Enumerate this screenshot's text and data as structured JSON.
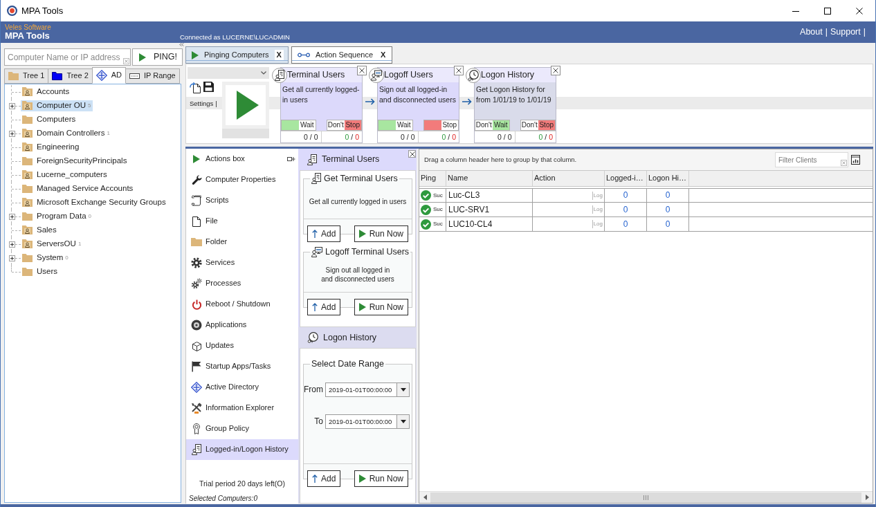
{
  "window": {
    "title": "MPA Tools"
  },
  "header": {
    "company": "Veles Software",
    "product": "MPA Tools",
    "connection": "Connected as LUCERNE\\LUCADMIN",
    "links": [
      {
        "label": "About",
        "separator": "|"
      },
      {
        "label": "Support",
        "separator": "|"
      }
    ]
  },
  "search": {
    "placeholder": "Computer Name or IP address",
    "button": "PING!"
  },
  "left_tabs": [
    {
      "label": "Tree 1",
      "selected": false
    },
    {
      "label": "Tree 2",
      "selected": false
    },
    {
      "label": "AD",
      "selected": true
    },
    {
      "label": "IP Range",
      "selected": false
    }
  ],
  "tree": [
    {
      "label": "Accounts",
      "kind": "ou",
      "selected": false
    },
    {
      "label": "Computer OU",
      "kind": "ou",
      "count": "5",
      "expanded": false,
      "selected": true
    },
    {
      "label": "Computers",
      "kind": "folder",
      "selected": false
    },
    {
      "label": "Domain Controllers",
      "kind": "ou",
      "count": "1",
      "expanded": false,
      "selected": false
    },
    {
      "label": "Engineering",
      "kind": "ou",
      "selected": false
    },
    {
      "label": "ForeignSecurityPrincipals",
      "kind": "folder",
      "selected": false
    },
    {
      "label": "Lucerne_computers",
      "kind": "ou",
      "selected": false
    },
    {
      "label": "Managed Service Accounts",
      "kind": "folder",
      "selected": false
    },
    {
      "label": "Microsoft Exchange Security Groups",
      "kind": "ou",
      "selected": false
    },
    {
      "label": "Program Data",
      "kind": "folder",
      "count": "0",
      "expanded": false,
      "selected": false
    },
    {
      "label": "Sales",
      "kind": "ou",
      "selected": false
    },
    {
      "label": "ServersOU",
      "kind": "ou",
      "count": "1",
      "expanded": false,
      "selected": false
    },
    {
      "label": "System",
      "kind": "folder",
      "count": "0",
      "expanded": false,
      "selected": false
    },
    {
      "label": "Users",
      "kind": "folder",
      "selected": false
    }
  ],
  "main_tabs": [
    {
      "label": "Pinging Computers",
      "close": "X",
      "selected": false
    },
    {
      "label": "Action Sequence",
      "close": "X",
      "selected": true
    }
  ],
  "sequence": {
    "settings": {
      "label": "Settings",
      "separator": "|"
    },
    "steps": [
      {
        "title": "Terminal Users",
        "description": "Get all currently logged-in users",
        "color": "#dcd9fb",
        "switches": [
          {
            "kind": "wait",
            "label": "Wait",
            "on": false
          },
          {
            "kind": "stop",
            "off_label": "Don't",
            "label": "Stop",
            "on": true
          }
        ],
        "progress": "0 / 0",
        "passed": "0",
        "separator": "/",
        "failed": "0"
      },
      {
        "title": "Logoff Users",
        "description": "Sign out all logged-in and disconnected users",
        "color": "#dcd9fb",
        "switches": [
          {
            "kind": "wait",
            "label": "Wait",
            "on": false
          },
          {
            "kind": "stop",
            "label": "Stop",
            "on": false
          }
        ],
        "progress": "0 / 0",
        "passed": "0",
        "separator": "/",
        "failed": "0"
      },
      {
        "title": "Logon History",
        "description": "Get Logon History for from 1/01/19 to 1/01/19",
        "color": "#d9dbea",
        "switches": [
          {
            "kind": "wait",
            "off_label": "Don't",
            "label": "Wait",
            "on": true
          },
          {
            "kind": "stop",
            "off_label": "Don't",
            "label": "Stop",
            "on": true
          }
        ],
        "progress": "0 / 0",
        "passed": "0",
        "separator": "/",
        "failed": "0"
      }
    ]
  },
  "actions": {
    "items": [
      {
        "label": "Actions box",
        "selected": false
      },
      {
        "label": "Computer Properties",
        "selected": false
      },
      {
        "label": "Scripts",
        "selected": false
      },
      {
        "label": "File",
        "selected": false
      },
      {
        "label": "Folder",
        "selected": false
      },
      {
        "label": "Services",
        "selected": false
      },
      {
        "label": "Processes",
        "selected": false
      },
      {
        "label": "Reboot / Shutdown",
        "selected": false
      },
      {
        "label": "Applications",
        "selected": false
      },
      {
        "label": "Updates",
        "selected": false
      },
      {
        "label": "Startup Apps/Tasks",
        "selected": false
      },
      {
        "label": "Active Directory",
        "selected": false
      },
      {
        "label": "Information Explorer",
        "selected": false
      },
      {
        "label": "Group Policy",
        "selected": false
      },
      {
        "label": "Logged-in/Logon History",
        "selected": true
      }
    ],
    "trial": "Trial period 20 days left(O)",
    "selected_computers": "Selected Computers:0"
  },
  "panels": [
    {
      "title": "Terminal Users",
      "groups": [
        {
          "title": "Get Terminal Users",
          "description": "Get all currently logged in users",
          "add": "Add",
          "run": "Run Now"
        },
        {
          "title": "Logoff Terminal Users",
          "description": "Sign out all logged in\nand disconnected users",
          "add": "Add",
          "run": "Run Now"
        }
      ]
    },
    {
      "title": "Logon History",
      "groups": [
        {
          "title": "Select Date Range",
          "fields": [
            {
              "label": "From",
              "value": "2019-01-01T00:00:00"
            },
            {
              "label": "To",
              "value": "2019-01-01T00:00:00"
            }
          ],
          "add": "Add",
          "run": "Run Now"
        }
      ]
    }
  ],
  "grid": {
    "group_hint": "Drag a column header here to group by that column.",
    "filter": {
      "placeholder": "Filter Clients"
    },
    "columns": [
      "Ping",
      "Name",
      "Action",
      "Logged-i…",
      "Logon Hi…"
    ],
    "rows": [
      {
        "ping": "Suc",
        "name": "Luc-CL3",
        "action": "Log",
        "logged_in": "0",
        "logon_history": "0"
      },
      {
        "ping": "Suc",
        "name": "LUC-SRV1",
        "action": "Log",
        "logged_in": "0",
        "logon_history": "0"
      },
      {
        "ping": "Suc",
        "name": "LUC10-CL4",
        "action": "Log",
        "logged_in": "0",
        "logon_history": "0"
      }
    ]
  }
}
